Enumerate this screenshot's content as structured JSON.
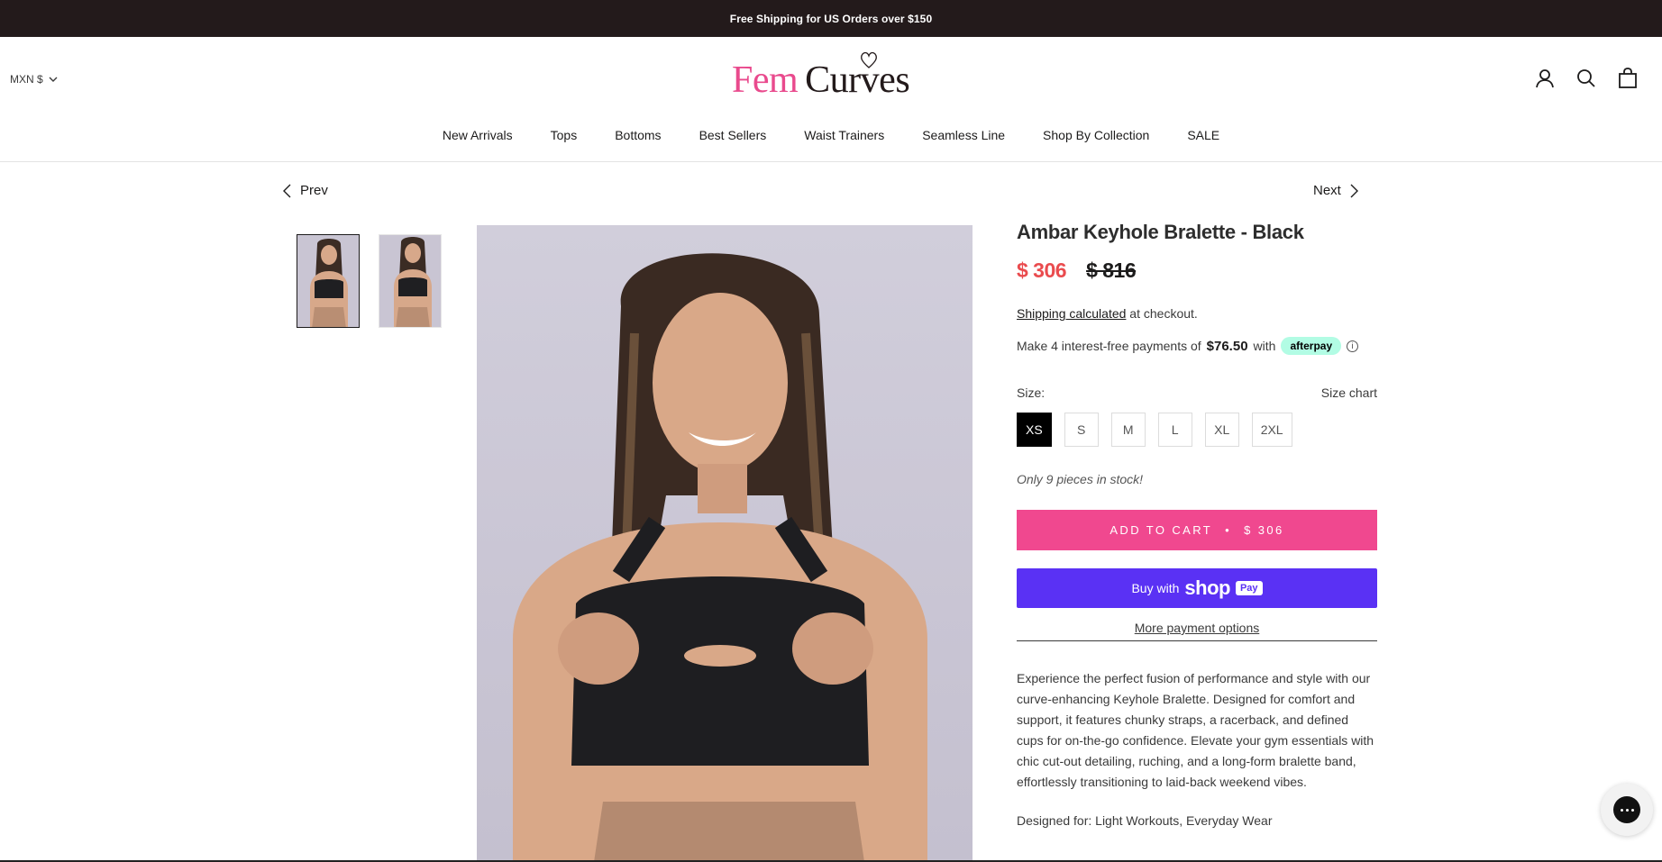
{
  "announcement": "Free Shipping for US Orders over $150",
  "header": {
    "currency": "MXN $",
    "logo_fem": "Fem",
    "logo_curves": "Curves",
    "icons": [
      "account-icon",
      "search-icon",
      "cart-icon"
    ]
  },
  "nav": {
    "items": [
      "New Arrivals",
      "Tops",
      "Bottoms",
      "Best Sellers",
      "Waist Trainers",
      "Seamless Line",
      "Shop By Collection",
      "SALE"
    ]
  },
  "pager": {
    "prev": "Prev",
    "next": "Next"
  },
  "product": {
    "title": "Ambar Keyhole Bralette - Black",
    "price_sale": "$ 306",
    "price_original": "$ 816",
    "shipping_link": "Shipping calculated",
    "shipping_rest": " at checkout.",
    "afterpay_prefix": "Make 4 interest-free payments of",
    "afterpay_amount": "$76.50",
    "afterpay_with": "with",
    "afterpay_badge": "afterpay",
    "size_label": "Size:",
    "size_chart": "Size chart",
    "sizes": [
      "XS",
      "S",
      "M",
      "L",
      "XL",
      "2XL"
    ],
    "selected_size": "XS",
    "stock": "Only 9 pieces in stock!",
    "add_to_cart": "ADD TO CART",
    "add_to_cart_price": "$ 306",
    "buy_with": "Buy with",
    "shop": "shop",
    "pay": "Pay",
    "more_payment": "More payment options",
    "description": "Experience the perfect fusion of performance and style with our curve-enhancing Keyhole Bralette. Designed for comfort and support, it features chunky straps, a racerback, and defined cups for on-the-go confidence. Elevate your gym essentials with chic cut-out detailing, ruching, and a long-form bralette band, effortlessly transitioning to laid-back weekend vibes.",
    "designed_for": "Designed for: Light Workouts, Everyday Wear"
  },
  "colors": {
    "accent_pink": "#f0488f",
    "sale_red": "#ea4b4e",
    "shop_pay_purple": "#5a31f4",
    "afterpay_mint": "#b2fce4",
    "announce_bg": "#231a1b"
  }
}
